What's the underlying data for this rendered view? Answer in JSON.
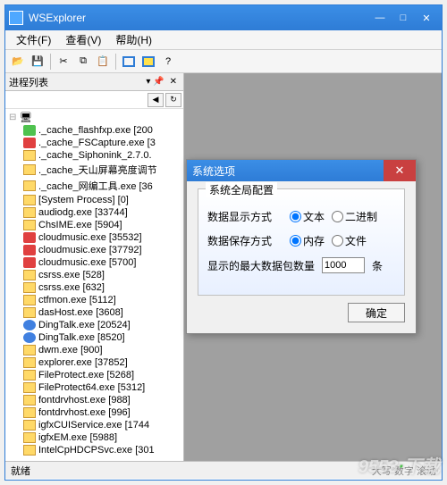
{
  "app": {
    "title": "WSExplorer",
    "menu": {
      "file": "文件(F)",
      "view": "查看(V)",
      "help": "帮助(H)"
    }
  },
  "sidebar": {
    "title": "进程列表",
    "items": [
      {
        "label": "._cache_flashfxp.exe [200",
        "icon": "exe-green"
      },
      {
        "label": "._cache_FSCapture.exe [3",
        "icon": "exe-red"
      },
      {
        "label": "._cache_Siphonink_2.7.0.",
        "icon": "exe-folder"
      },
      {
        "label": "._cache_天山屏幕亮度调节",
        "icon": "exe-folder"
      },
      {
        "label": "._cache_网编工具.exe [36",
        "icon": "exe-folder"
      },
      {
        "label": "[System Process] [0]",
        "icon": "exe-folder"
      },
      {
        "label": "audiodg.exe [33744]",
        "icon": "exe-folder"
      },
      {
        "label": "ChsIME.exe [5904]",
        "icon": "exe-folder"
      },
      {
        "label": "cloudmusic.exe [35532]",
        "icon": "exe-red"
      },
      {
        "label": "cloudmusic.exe [37792]",
        "icon": "exe-red"
      },
      {
        "label": "cloudmusic.exe [5700]",
        "icon": "exe-red"
      },
      {
        "label": "csrss.exe [528]",
        "icon": "exe-folder"
      },
      {
        "label": "csrss.exe [632]",
        "icon": "exe-folder"
      },
      {
        "label": "ctfmon.exe [5112]",
        "icon": "exe-folder"
      },
      {
        "label": "dasHost.exe [3608]",
        "icon": "exe-folder"
      },
      {
        "label": "DingTalk.exe [20524]",
        "icon": "exe-blue"
      },
      {
        "label": "DingTalk.exe [8520]",
        "icon": "exe-blue"
      },
      {
        "label": "dwm.exe [900]",
        "icon": "exe-folder"
      },
      {
        "label": "explorer.exe [37852]",
        "icon": "exe-folder"
      },
      {
        "label": "FileProtect.exe [5268]",
        "icon": "exe-folder"
      },
      {
        "label": "FileProtect64.exe [5312]",
        "icon": "exe-folder"
      },
      {
        "label": "fontdrvhost.exe [988]",
        "icon": "exe-folder"
      },
      {
        "label": "fontdrvhost.exe [996]",
        "icon": "exe-folder"
      },
      {
        "label": "igfxCUIService.exe [1744",
        "icon": "exe-folder"
      },
      {
        "label": "igfxEM.exe [5988]",
        "icon": "exe-folder"
      },
      {
        "label": "IntelCpHDCPSvc.exe [301",
        "icon": "exe-folder"
      }
    ]
  },
  "dialog": {
    "title": "系统选项",
    "group_title": "系统全局配置",
    "row1_label": "数据显示方式",
    "row1_opt1": "文本",
    "row1_opt2": "二进制",
    "row2_label": "数据保存方式",
    "row2_opt1": "内存",
    "row2_opt2": "文件",
    "row3_label": "显示的最大数据包数量",
    "row3_value": "1000",
    "row3_suffix": "条",
    "ok": "确定"
  },
  "status": {
    "left": "就绪",
    "right": "大写 数字 滚动"
  },
  "watermark": {
    "a": "9553",
    "b": "下载"
  }
}
